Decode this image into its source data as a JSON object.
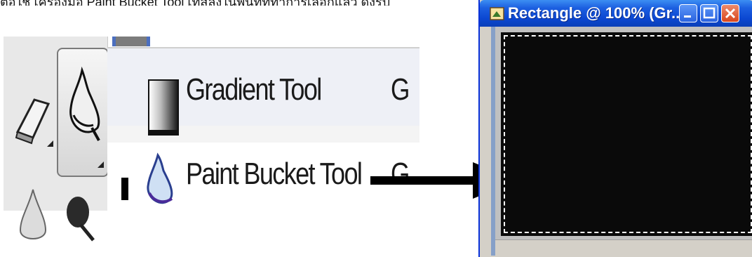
{
  "header_cutoff_text": "ต่อใช้ เครื่องมือ Paint Bucket Tool เทสีลงในพื้นที่ที่ทำการเลือกแล้ว ดังรูป",
  "toolbox": {
    "tools": [
      "eraser-icon",
      "paint-bucket-icon",
      "blur-icon",
      "burn-icon"
    ],
    "active_tool": "paint-bucket-icon"
  },
  "flyout_menu": {
    "items": [
      {
        "label": "Gradient Tool",
        "shortcut": "G",
        "icon": "gradient-icon",
        "selected": false
      },
      {
        "label": "Paint Bucket Tool",
        "shortcut": "G",
        "icon": "paint-bucket-icon",
        "selected": true
      }
    ]
  },
  "document_window": {
    "title": "Rectangle @ 100% (Gr...",
    "canvas_color": "#0a0a0a",
    "controls": [
      "minimize-icon",
      "maximize-icon",
      "close-icon"
    ]
  },
  "colors": {
    "titlebar": "#0b47d1",
    "menu_highlight": "#eef0f6",
    "canvas": "#0a0a0a"
  }
}
